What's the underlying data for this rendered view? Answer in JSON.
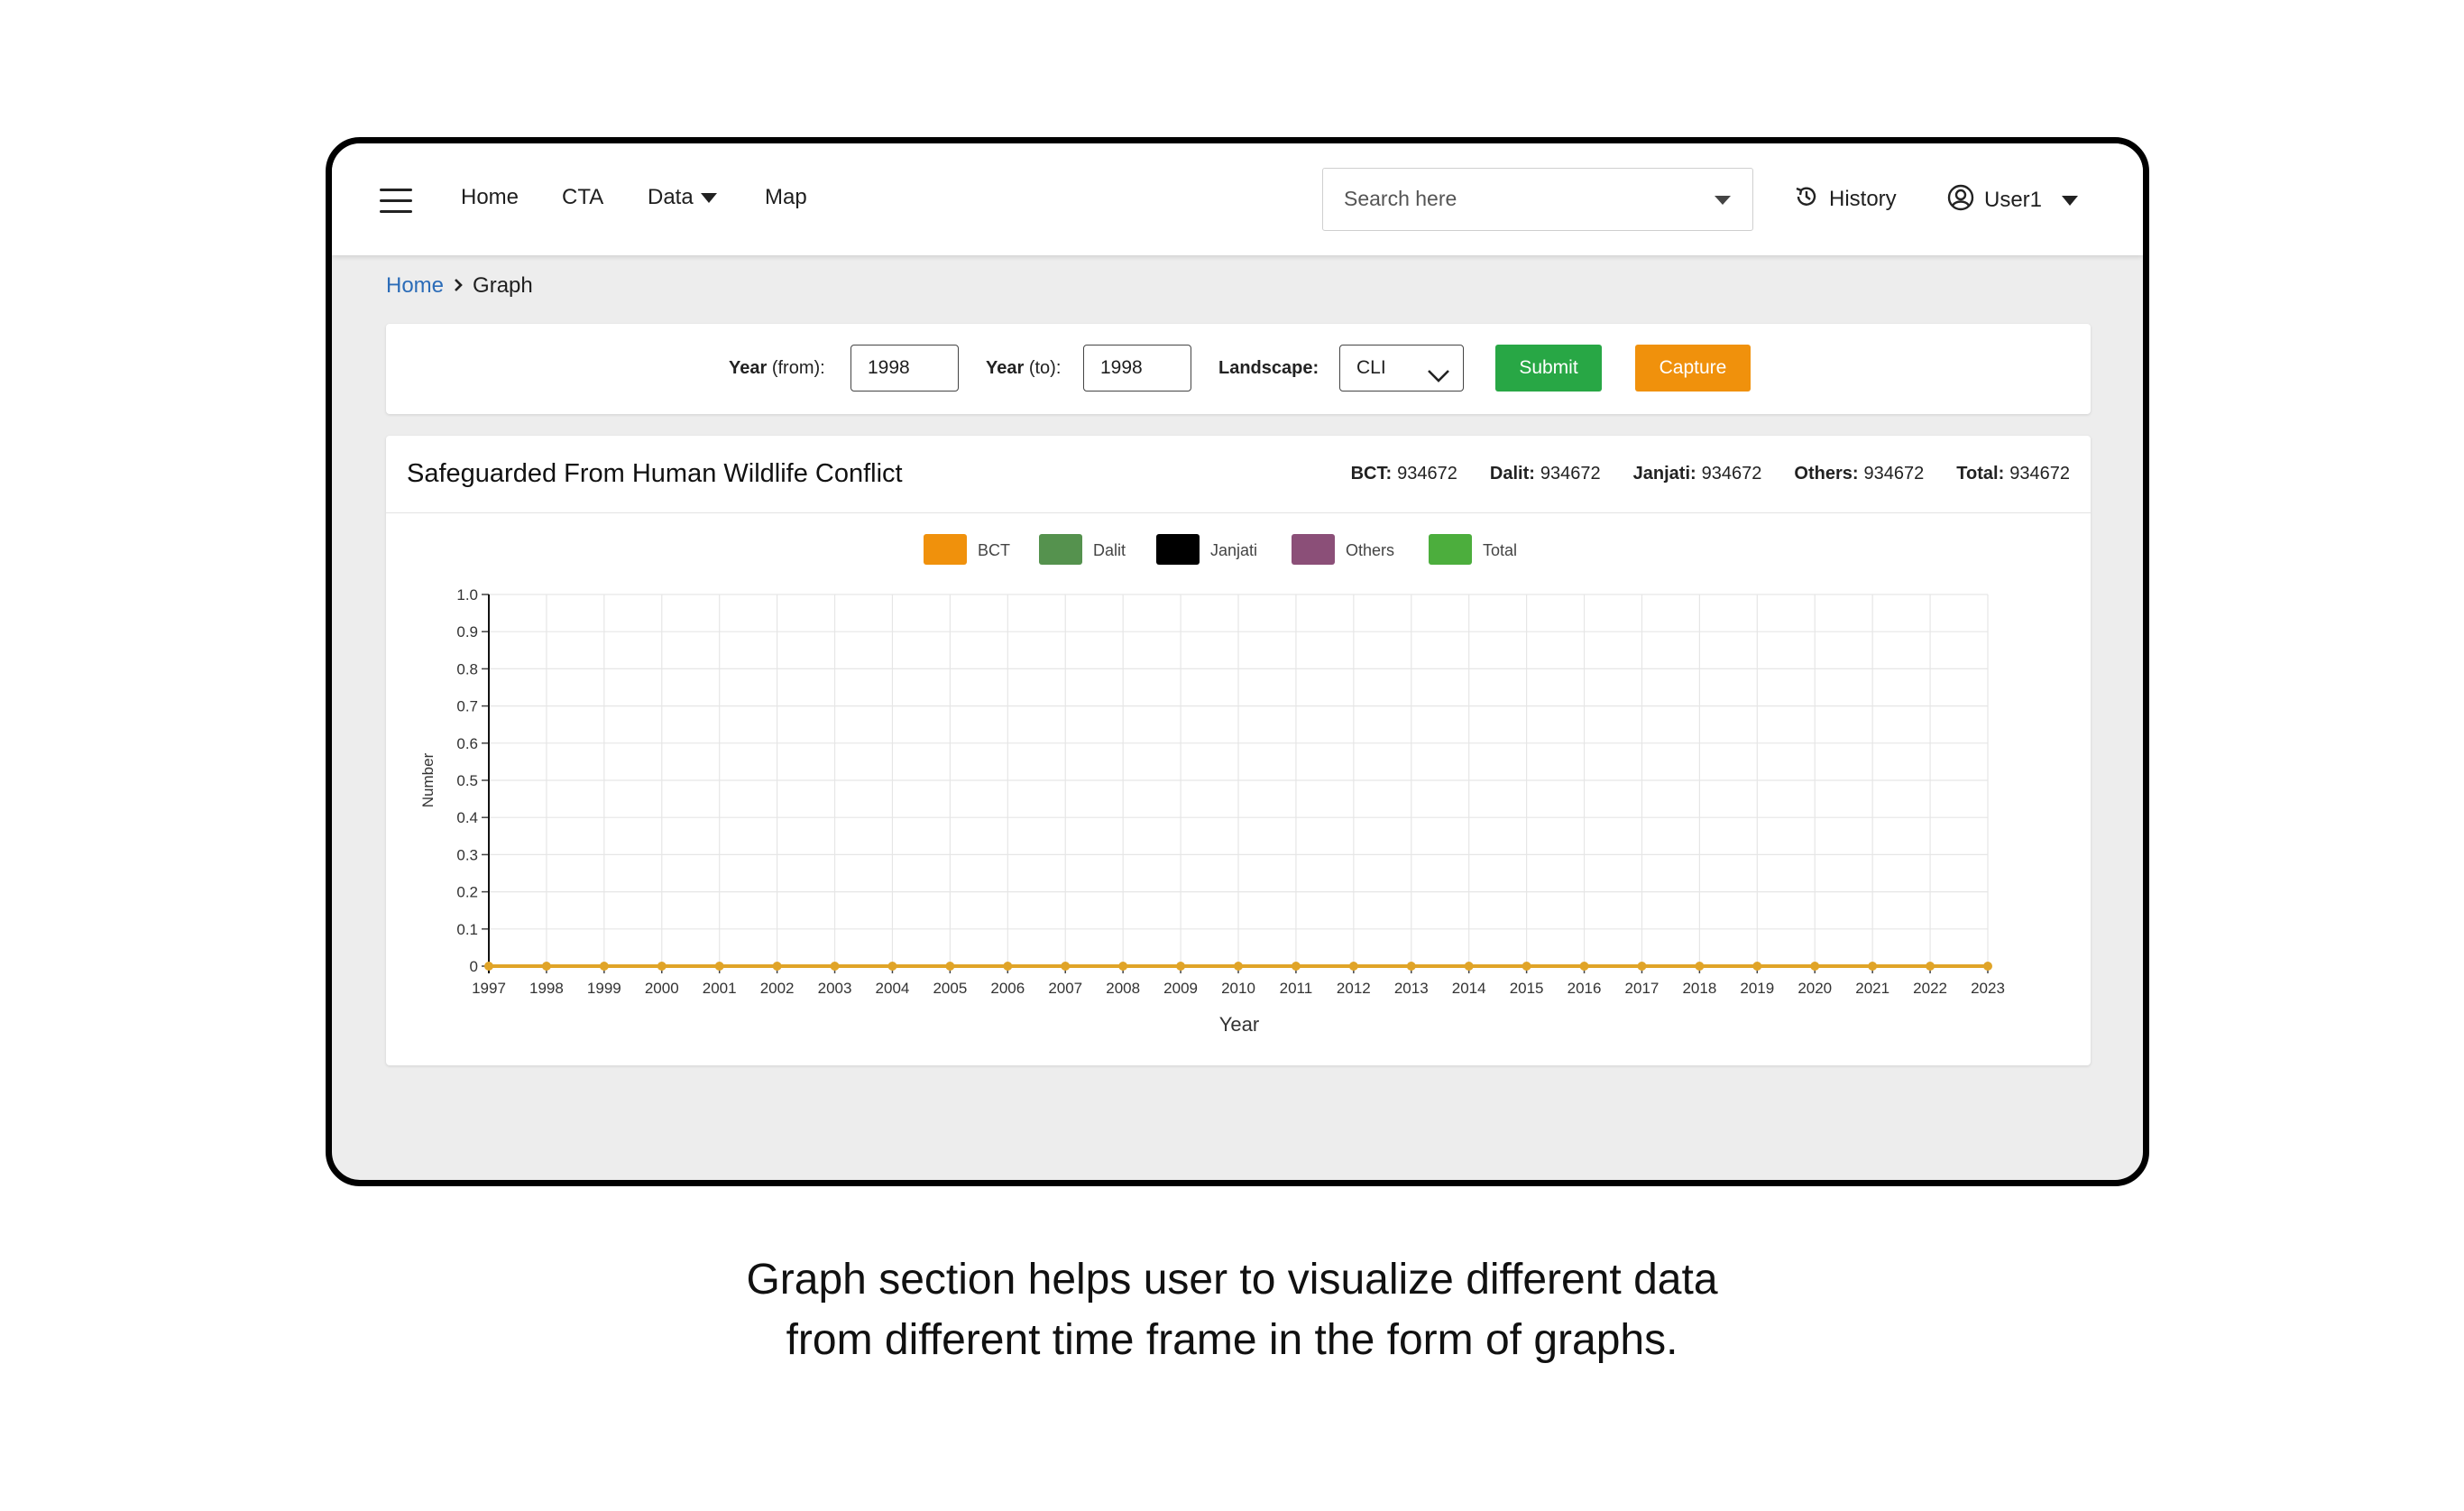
{
  "nav": {
    "menu_icon": "hamburger-icon",
    "items": [
      "Home",
      "CTA",
      "Data",
      "Map"
    ],
    "search_placeholder": "Search here",
    "history_label": "History",
    "history_icon": "clock-history-icon",
    "user_label": "User1",
    "user_icon": "user-circle-icon"
  },
  "breadcrumb": {
    "home": "Home",
    "current": "Graph"
  },
  "filters": {
    "year_from_label": "Year",
    "year_from_suffix": "(from):",
    "year_from_value": "1998",
    "year_to_label": "Year",
    "year_to_suffix": "(to):",
    "year_to_value": "1998",
    "landscape_label": "Landscape:",
    "landscape_value": "CLI",
    "submit_label": "Submit",
    "capture_label": "Capture",
    "submit_color": "#28a745",
    "capture_color": "#f0910c"
  },
  "chart_card": {
    "title": "Safeguarded From Human Wildlife Conflict",
    "stats": [
      {
        "label": "BCT:",
        "value": "934672"
      },
      {
        "label": "Dalit:",
        "value": "934672"
      },
      {
        "label": "Janjati:",
        "value": "934672"
      },
      {
        "label": "Others:",
        "value": "934672"
      },
      {
        "label": "Total:",
        "value": "934672"
      }
    ]
  },
  "chart_data": {
    "type": "line",
    "x": [
      "1997",
      "1998",
      "1999",
      "2000",
      "2001",
      "2002",
      "2003",
      "2004",
      "2005",
      "2006",
      "2007",
      "2008",
      "2009",
      "2010",
      "2011",
      "2012",
      "2013",
      "2014",
      "2015",
      "2016",
      "2017",
      "2018",
      "2019",
      "2020",
      "2021",
      "2022",
      "2023"
    ],
    "series": [
      {
        "name": "BCT",
        "color": "#f0910c",
        "values": [
          0,
          0,
          0,
          0,
          0,
          0,
          0,
          0,
          0,
          0,
          0,
          0,
          0,
          0,
          0,
          0,
          0,
          0,
          0,
          0,
          0,
          0,
          0,
          0,
          0,
          0,
          0
        ]
      },
      {
        "name": "Dalit",
        "color": "#55924e",
        "values": [
          0,
          0,
          0,
          0,
          0,
          0,
          0,
          0,
          0,
          0,
          0,
          0,
          0,
          0,
          0,
          0,
          0,
          0,
          0,
          0,
          0,
          0,
          0,
          0,
          0,
          0,
          0
        ]
      },
      {
        "name": "Janjati",
        "color": "#000000",
        "values": [
          0,
          0,
          0,
          0,
          0,
          0,
          0,
          0,
          0,
          0,
          0,
          0,
          0,
          0,
          0,
          0,
          0,
          0,
          0,
          0,
          0,
          0,
          0,
          0,
          0,
          0,
          0
        ]
      },
      {
        "name": "Others",
        "color": "#8b4f78",
        "values": [
          0,
          0,
          0,
          0,
          0,
          0,
          0,
          0,
          0,
          0,
          0,
          0,
          0,
          0,
          0,
          0,
          0,
          0,
          0,
          0,
          0,
          0,
          0,
          0,
          0,
          0,
          0
        ]
      },
      {
        "name": "Total",
        "color": "#4cae3d",
        "values": [
          0,
          0,
          0,
          0,
          0,
          0,
          0,
          0,
          0,
          0,
          0,
          0,
          0,
          0,
          0,
          0,
          0,
          0,
          0,
          0,
          0,
          0,
          0,
          0,
          0,
          0,
          0
        ]
      }
    ],
    "yticks": [
      "0",
      "0.1",
      "0.2",
      "0.3",
      "0.4",
      "0.5",
      "0.6",
      "0.7",
      "0.8",
      "0.9",
      "1.0"
    ],
    "ylim": [
      0,
      1.0
    ],
    "xlabel": "Year",
    "ylabel": "Number",
    "grid": true,
    "legend_position": "top-center",
    "line_color": "#e0a428"
  },
  "caption": {
    "line1": "Graph section helps user to visualize different data",
    "line2": "from different time frame in the form of graphs."
  }
}
